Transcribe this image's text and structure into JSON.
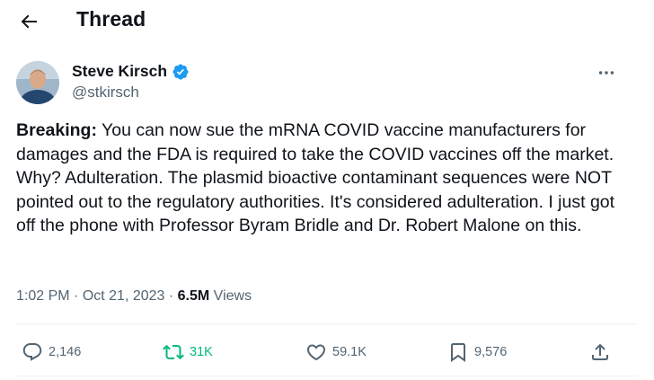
{
  "header": {
    "title": "Thread"
  },
  "author": {
    "name": "Steve Kirsch",
    "handle": "@stkirsch"
  },
  "tweet": {
    "prefix": "Breaking:",
    "text": " You can now sue the mRNA COVID vaccine manufacturers for damages and the FDA is required to take the COVID vaccines off the market. Why? Adulteration. The plasmid bioactive contaminant sequences were NOT pointed out to the regulatory authorities. It's considered adulteration. I just got off the phone with Professor Byram Bridle and Dr. Robert Malone on this."
  },
  "meta": {
    "time": "1:02 PM",
    "sep1": " · ",
    "date": "Oct 21, 2023",
    "sep2": " · ",
    "views_count": "6.5M",
    "views_label": " Views"
  },
  "actions": {
    "replies": "2,146",
    "retweets": "31K",
    "likes": "59.1K",
    "bookmarks": "9,576"
  },
  "colors": {
    "retweet_active": "#00ba7c",
    "verified": "#1d9bf0",
    "secondary_text": "#536471"
  }
}
